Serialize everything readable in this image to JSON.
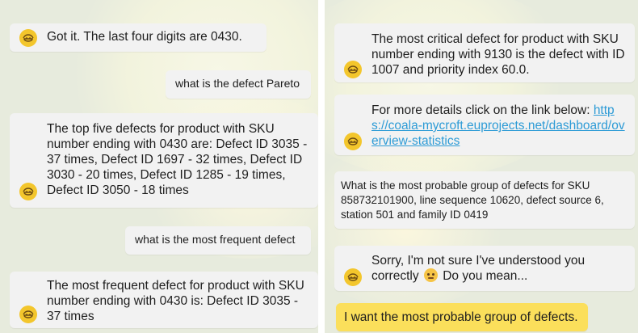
{
  "left": {
    "messages": [
      {
        "from": "bot",
        "text": "Got it. The last four digits are 0430."
      },
      {
        "from": "user",
        "text": "what is the defect Pareto"
      },
      {
        "from": "bot",
        "text": "The top five defects for product with SKU number ending with 0430 are: Defect ID 3035 - 37 times, Defect ID 1697 - 32 times, Defect ID 3030 - 20 times, Defect ID 1285 - 19 times, Defect ID 3050 - 18 times"
      },
      {
        "from": "user",
        "text": "what is the most frequent defect"
      },
      {
        "from": "bot",
        "text": "The most frequent defect for product with SKU number ending with 0430 is: Defect ID 3035 - 37 times"
      }
    ]
  },
  "right": {
    "messages": [
      {
        "from": "bot",
        "text": "The most critical defect for product with SKU number ending with 9130 is the defect with ID 1007 and priority index 60.0."
      },
      {
        "from": "bot",
        "text": "For more details click on the link below: ",
        "link": "https://coala-mycroft.euprojects.net/dashboard/overview-statistics"
      },
      {
        "from": "user",
        "text": "What is the most probable group of defects for SKU 858732101900, line sequence 10620, defect source 6, station 501 and family ID 0419"
      },
      {
        "from": "bot",
        "text": "Sorry, I'm not sure I've understood you correctly",
        "text_after": " Do you mean...",
        "emoji": "thinking-face"
      },
      {
        "from": "suggestion",
        "text": "I want the most probable group of defects."
      }
    ]
  },
  "colors": {
    "background": "#e7ebdd",
    "bubble": "#f2f2f2",
    "avatar": "#f3c62c",
    "link": "#2d9bd6",
    "suggestion": "#fbdf5b"
  },
  "icons": {
    "bot_avatar": "bot-face-icon",
    "emoji": "thinking-face-emoji-icon"
  }
}
